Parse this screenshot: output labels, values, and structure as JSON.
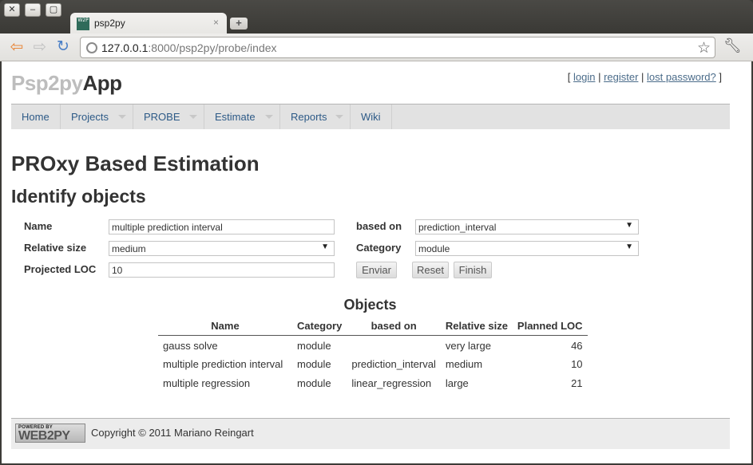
{
  "browser": {
    "tab_title": "psp2py",
    "favicon_text": "W2P",
    "url_host": "127.0.0.1",
    "url_rest": ":8000/psp2py/probe/index"
  },
  "app": {
    "brand_light": "Psp2py",
    "brand_dark": "App",
    "auth": {
      "open": "[ ",
      "login": "login",
      "sep1": " | ",
      "register": "register",
      "sep2": " | ",
      "lost_password": "lost password?",
      "close": " ]"
    }
  },
  "menu": [
    {
      "label": "Home",
      "dropdown": false
    },
    {
      "label": "Projects",
      "dropdown": true
    },
    {
      "label": "PROBE",
      "dropdown": true
    },
    {
      "label": "Estimate",
      "dropdown": true
    },
    {
      "label": "Reports",
      "dropdown": true
    },
    {
      "label": "Wiki",
      "dropdown": false
    }
  ],
  "page": {
    "title": "PROxy Based Estimation",
    "subtitle": "Identify objects"
  },
  "form": {
    "name_label": "Name",
    "name_value": "multiple prediction interval",
    "relative_size_label": "Relative size",
    "relative_size_value": "medium",
    "projected_loc_label": "Projected LOC",
    "projected_loc_value": "10",
    "based_on_label": "based on",
    "based_on_value": "prediction_interval",
    "category_label": "Category",
    "category_value": "module",
    "submit_label": "Enviar",
    "reset_label": "Reset",
    "finish_label": "Finish"
  },
  "objects": {
    "heading": "Objects",
    "columns": [
      "Name",
      "Category",
      "based on",
      "Relative size",
      "Planned LOC"
    ],
    "rows": [
      [
        "gauss solve",
        "module",
        "",
        "very large",
        "46"
      ],
      [
        "multiple prediction interval",
        "module",
        "prediction_interval",
        "medium",
        "10"
      ],
      [
        "multiple regression",
        "module",
        "linear_regression",
        "large",
        "21"
      ]
    ]
  },
  "footer": {
    "badge_small": "POWERED BY",
    "badge_big": "WEB2PY",
    "copyright": "Copyright © 2011 Mariano Reingart"
  },
  "icons": {
    "back": "back-arrow-icon",
    "forward": "forward-arrow-icon",
    "reload": "reload-icon",
    "star": "bookmark-star-icon",
    "wrench": "wrench-icon"
  },
  "colors": {
    "link": "#2d5a87",
    "menubar": "#e2e2e2",
    "back_arrow": "#e8873a",
    "reload": "#4a7fc6"
  }
}
